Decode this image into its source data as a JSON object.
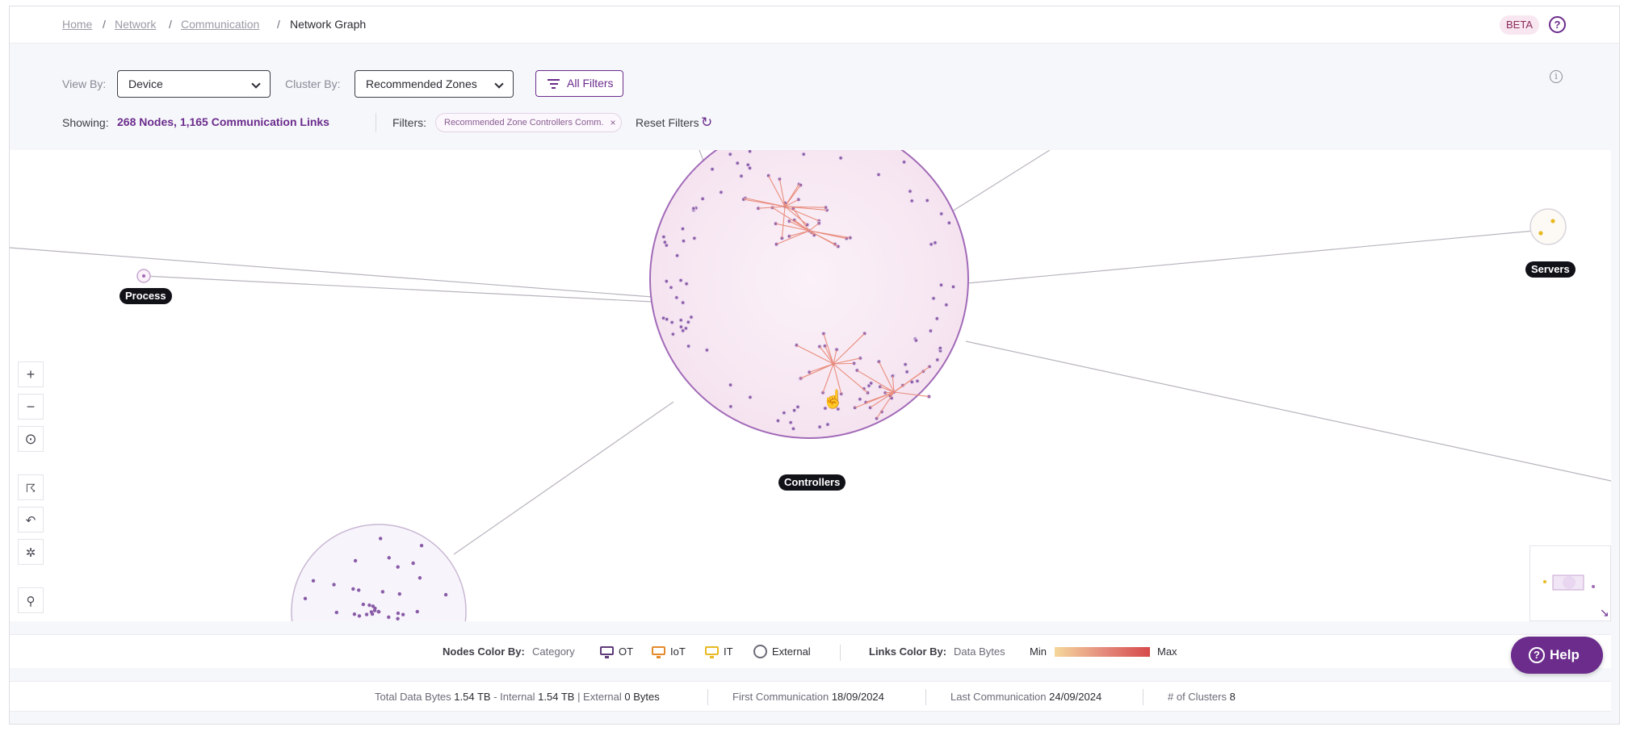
{
  "breadcrumb": {
    "home": "Home",
    "network": "Network",
    "communication": "Communication",
    "current": "Network Graph",
    "separator": "/"
  },
  "badge": {
    "label": "BETA",
    "help": "?"
  },
  "controls": {
    "view_by_label": "View By:",
    "view_by_value": "Device",
    "cluster_by_label": "Cluster By:",
    "cluster_by_value": "Recommended Zones",
    "all_filters": "All Filters",
    "showing_label": "Showing:",
    "showing_value": "268 Nodes, 1,165 Communication Links",
    "filters_label": "Filters:",
    "filter_chip": "Recommended Zone Controllers Comm.",
    "chip_close": "×",
    "reset_filters": "Reset Filters"
  },
  "graph": {
    "clusters": {
      "process": "Process",
      "controllers": "Controllers",
      "servers": "Servers"
    }
  },
  "tools": {
    "zoom_in": "+",
    "zoom_out": "−"
  },
  "legend": {
    "nodes_color_by_label": "Nodes Color By:",
    "nodes_color_by_value": "Category",
    "ot": "OT",
    "iot": "IoT",
    "it": "IT",
    "external": "External",
    "links_color_by_label": "Links Color By:",
    "links_color_by_value": "Data Bytes",
    "min": "Min",
    "max": "Max",
    "colors": {
      "ot": "#5e3a7a",
      "iot": "#e58a2b",
      "it": "#e8b923",
      "external": "#6b6b78"
    }
  },
  "help": {
    "label": "Help",
    "icon": "?"
  },
  "stats": {
    "total_label": "Total Data Bytes",
    "total_value": "1.54 TB",
    "internal_label": "- Internal",
    "internal_value": "1.54 TB",
    "external_label": "| External",
    "external_value": "0 Bytes",
    "first_label": "First Communication",
    "first_value": "18/09/2024",
    "last_label": "Last Communication",
    "last_value": "24/09/2024",
    "clusters_label": "# of Clusters",
    "clusters_value": "8"
  }
}
